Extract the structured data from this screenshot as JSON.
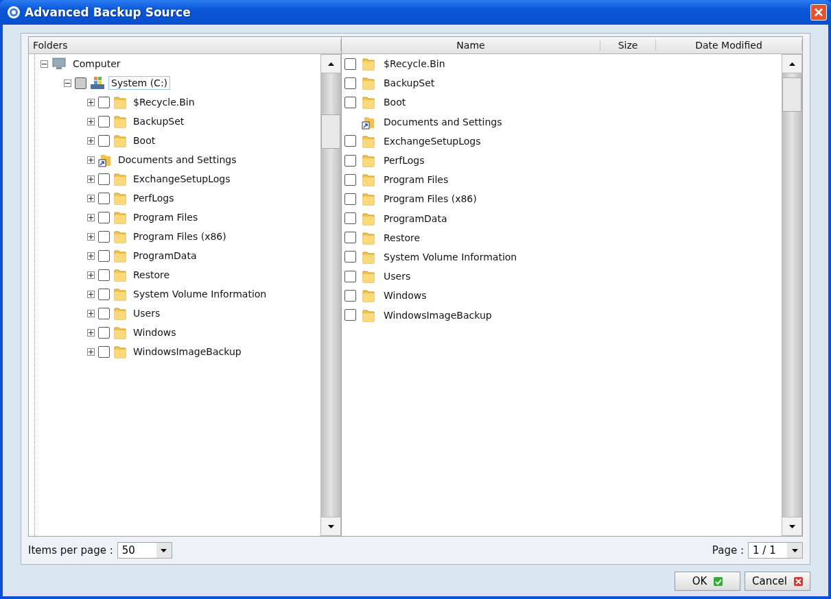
{
  "window": {
    "title": "Advanced Backup Source"
  },
  "folders_pane": {
    "header": "Folders",
    "tree": [
      {
        "label": "Computer",
        "kind": "computer",
        "expanded": true,
        "children": [
          {
            "label": "System (C:)",
            "kind": "drive",
            "expanded": true,
            "checked": false,
            "selected": true,
            "children": [
              {
                "label": "$Recycle.Bin",
                "kind": "folder",
                "checked": false,
                "expanded": false
              },
              {
                "label": "BackupSet",
                "kind": "folder",
                "checked": false,
                "expanded": false
              },
              {
                "label": "Boot",
                "kind": "folder",
                "checked": false,
                "expanded": false
              },
              {
                "label": "Documents and Settings",
                "kind": "shortcut",
                "expanded": false
              },
              {
                "label": "ExchangeSetupLogs",
                "kind": "folder",
                "checked": false,
                "expanded": false
              },
              {
                "label": "PerfLogs",
                "kind": "folder",
                "checked": false,
                "expanded": false
              },
              {
                "label": "Program Files",
                "kind": "folder",
                "checked": false,
                "expanded": false
              },
              {
                "label": "Program Files (x86)",
                "kind": "folder",
                "checked": false,
                "expanded": false
              },
              {
                "label": "ProgramData",
                "kind": "folder",
                "checked": false,
                "expanded": false
              },
              {
                "label": "Restore",
                "kind": "folder",
                "checked": false,
                "expanded": false
              },
              {
                "label": "System Volume Information",
                "kind": "folder",
                "checked": false,
                "expanded": false
              },
              {
                "label": "Users",
                "kind": "folder",
                "checked": false,
                "expanded": false
              },
              {
                "label": "Windows",
                "kind": "folder",
                "checked": false,
                "expanded": false
              },
              {
                "label": "WindowsImageBackup",
                "kind": "folder",
                "checked": false,
                "expanded": false
              }
            ]
          }
        ]
      }
    ]
  },
  "file_list": {
    "columns": [
      "Name",
      "Size",
      "Date Modified"
    ],
    "rows": [
      {
        "name": "$Recycle.Bin",
        "kind": "folder",
        "checked": false
      },
      {
        "name": "BackupSet",
        "kind": "folder",
        "checked": false
      },
      {
        "name": "Boot",
        "kind": "folder",
        "checked": false
      },
      {
        "name": "Documents and Settings",
        "kind": "shortcut"
      },
      {
        "name": "ExchangeSetupLogs",
        "kind": "folder",
        "checked": false
      },
      {
        "name": "PerfLogs",
        "kind": "folder",
        "checked": false
      },
      {
        "name": "Program Files",
        "kind": "folder",
        "checked": false
      },
      {
        "name": "Program Files (x86)",
        "kind": "folder",
        "checked": false
      },
      {
        "name": "ProgramData",
        "kind": "folder",
        "checked": false
      },
      {
        "name": "Restore",
        "kind": "folder",
        "checked": false
      },
      {
        "name": "System Volume Information",
        "kind": "folder",
        "checked": false
      },
      {
        "name": "Users",
        "kind": "folder",
        "checked": false
      },
      {
        "name": "Windows",
        "kind": "folder",
        "checked": false
      },
      {
        "name": "WindowsImageBackup",
        "kind": "folder",
        "checked": false
      }
    ]
  },
  "footer": {
    "items_per_page_label": "Items per page :",
    "items_per_page": "50",
    "page_label": "Page :",
    "page": "1 / 1"
  },
  "buttons": [
    {
      "label": "OK",
      "kind": "ok"
    },
    {
      "label": "Cancel",
      "kind": "cancel"
    }
  ]
}
